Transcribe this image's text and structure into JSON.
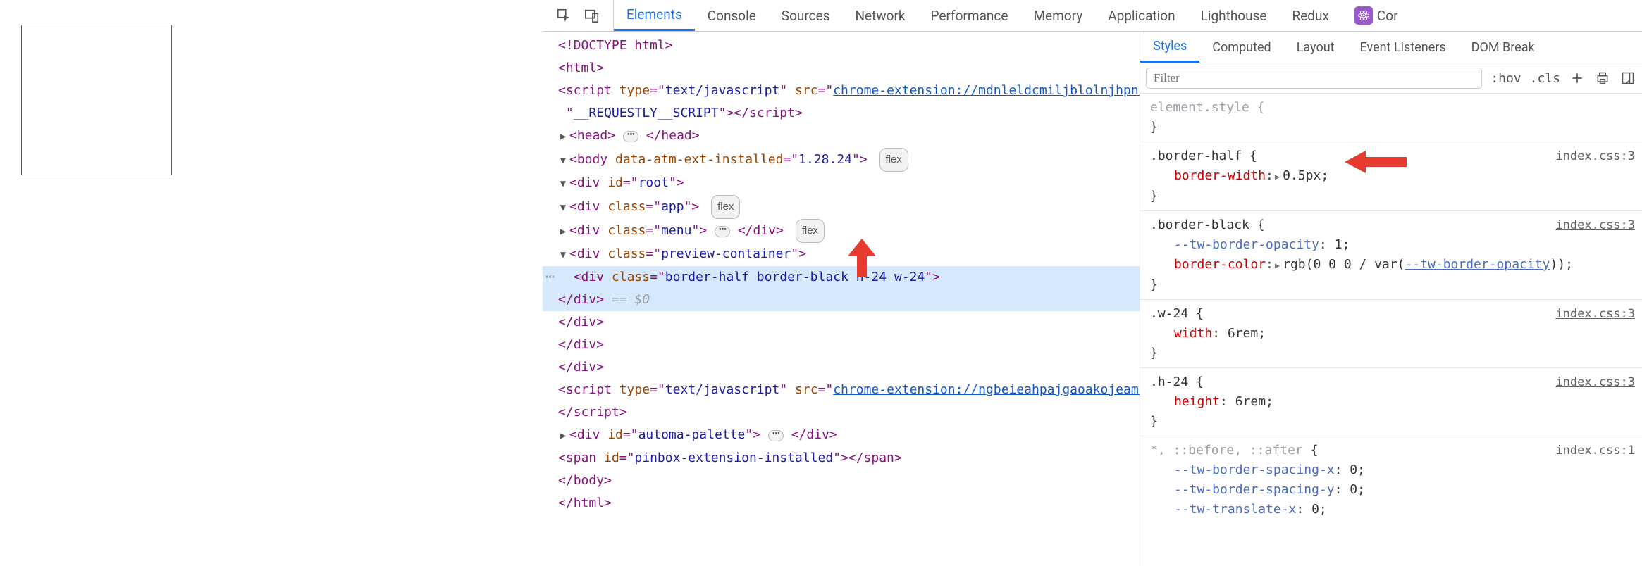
{
  "toolbar": {
    "tabs": [
      "Elements",
      "Console",
      "Sources",
      "Network",
      "Performance",
      "Memory",
      "Application",
      "Lighthouse",
      "Redux",
      "Cor"
    ]
  },
  "elements": {
    "doctype": "<!DOCTYPE html>",
    "html_open": "html",
    "script1": {
      "tag": "script",
      "type": "text/javascript",
      "src": "chrome-extension://mdnleldcmiljblolnjhpnblkcekpdkpa/libs/customElements.js",
      "class": "__REQUESTLY__SCRIPT"
    },
    "head": "head",
    "body": {
      "tag": "body",
      "attr": "data-atm-ext-installed",
      "val": "1.28.24",
      "badge": "flex"
    },
    "root": {
      "tag": "div",
      "attr": "id",
      "val": "root"
    },
    "app": {
      "tag": "div",
      "attr": "class",
      "val": "app",
      "badge": "flex"
    },
    "menu": {
      "tag": "div",
      "attr": "class",
      "val": "menu",
      "badge": "flex"
    },
    "preview": {
      "tag": "div",
      "attr": "class",
      "val": "preview-container"
    },
    "target": {
      "tag": "div",
      "attr": "class",
      "val": "border-half border-black h-24 w-24"
    },
    "eq0": "== $0",
    "script2": {
      "tag": "script",
      "type": "text/javascript",
      "src": "chrome-extension://ngbeieahpajgaoakojeamhkacekiicfk/js/inject.min.js"
    },
    "automa": {
      "tag": "div",
      "attr": "id",
      "val": "automa-palette"
    },
    "pinbox": {
      "tag": "span",
      "attr": "id",
      "val": "pinbox-extension-installed"
    }
  },
  "styles": {
    "subtabs": [
      "Styles",
      "Computed",
      "Layout",
      "Event Listeners",
      "DOM Break"
    ],
    "filter_placeholder": "Filter",
    "hov": ":hov",
    "cls": ".cls",
    "element_style": "element.style {",
    "rules": [
      {
        "selector": ".border-half",
        "source": "index.css:3",
        "props": [
          {
            "n": "border-width",
            "v": "0.5px",
            "tri": true
          }
        ]
      },
      {
        "selector": ".border-black",
        "source": "index.css:3",
        "props": [
          {
            "n": "--tw-border-opacity",
            "v": "1",
            "custom": true
          },
          {
            "n": "border-color",
            "v_pre": "rgb(0 0 0 / var(",
            "v_link": "--tw-border-opacity",
            "v_post": "));",
            "tri": true
          }
        ]
      },
      {
        "selector": ".w-24",
        "source": "index.css:3",
        "props": [
          {
            "n": "width",
            "v": "6rem"
          }
        ]
      },
      {
        "selector": ".h-24",
        "source": "index.css:3",
        "props": [
          {
            "n": "height",
            "v": "6rem"
          }
        ]
      },
      {
        "selector_gray": "*, ::before, ::after",
        "source": "index.css:1",
        "props": [
          {
            "n": "--tw-border-spacing-x",
            "v": "0",
            "custom": true
          },
          {
            "n": "--tw-border-spacing-y",
            "v": "0",
            "custom": true
          },
          {
            "n": "--tw-translate-x",
            "v": "0",
            "custom": true
          }
        ]
      }
    ]
  }
}
